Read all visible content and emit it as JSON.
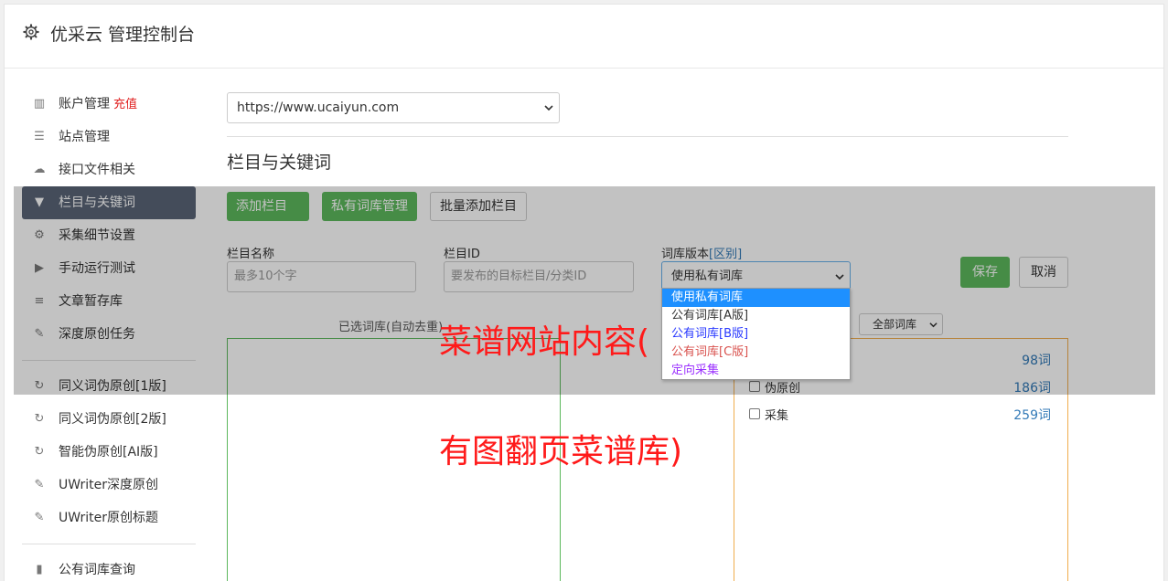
{
  "app": {
    "title": "优采云 管理控制台"
  },
  "sidebar": {
    "items": [
      {
        "label": "账户管理",
        "extra": "充值",
        "icon": "bar-chart-icon",
        "glyph": "▥"
      },
      {
        "label": "站点管理",
        "icon": "server-icon",
        "glyph": "☰"
      },
      {
        "label": "接口文件相关",
        "icon": "cloud-upload-icon",
        "glyph": "☁"
      },
      {
        "label": "栏目与关键词",
        "icon": "filter-icon",
        "glyph": "▼",
        "active": true
      },
      {
        "label": "采集细节设置",
        "icon": "cogs-icon",
        "glyph": "⚙"
      },
      {
        "label": "手动运行测试",
        "icon": "play-circle-icon",
        "glyph": "▶"
      },
      {
        "label": "文章暂存库",
        "icon": "database-icon",
        "glyph": "≡"
      },
      {
        "label": "深度原创任务",
        "icon": "edit-icon",
        "glyph": "✎"
      }
    ],
    "items2": [
      {
        "label": "同义词伪原创[1版]",
        "icon": "refresh-icon",
        "glyph": "↻"
      },
      {
        "label": "同义词伪原创[2版]",
        "icon": "refresh-icon",
        "glyph": "↻"
      },
      {
        "label": "智能伪原创[AI版]",
        "icon": "refresh-icon",
        "glyph": "↻"
      },
      {
        "label": "UWriter深度原创",
        "icon": "edit-icon",
        "glyph": "✎"
      },
      {
        "label": "UWriter原创标题",
        "icon": "edit-icon",
        "glyph": "✎"
      }
    ],
    "items3": [
      {
        "label": "公有词库查询",
        "icon": "book-icon",
        "glyph": "▮"
      }
    ]
  },
  "main": {
    "site_url": "https://www.ucaiyun.com",
    "section_title": "栏目与关键词",
    "buttons": {
      "add_column": "添加栏目 +",
      "private_lib": "私有词库管理",
      "batch_add": "批量添加栏目",
      "save": "保存",
      "cancel": "取消"
    },
    "form": {
      "name_label": "栏目名称",
      "name_placeholder": "最多10个字",
      "id_label": "栏目ID",
      "id_placeholder": "要发布的目标栏目/分类ID",
      "version_label": "词库版本",
      "version_link": "[区别]",
      "version_value": "使用私有词库"
    },
    "version_options": [
      "使用私有词库",
      "公有词库[A版]",
      "公有词库[B版]",
      "公有词库[C版]",
      "定向采集"
    ],
    "chosen_label": "已选词库(自动去重)",
    "filter_value": "全部词库",
    "libraries": [
      {
        "name": "",
        "count": "98词"
      },
      {
        "name": "伪原创",
        "count": "186词"
      },
      {
        "name": "采集",
        "count": "259词"
      }
    ]
  },
  "overlay": {
    "line1": "菜谱网站内容(",
    "line2": "有图翻页菜谱库)"
  },
  "colors": {
    "active_nav": "#5a6577",
    "green": "#5cb85c",
    "orange": "#f0ad4e",
    "link": "#337ab7",
    "red": "#ff1a1a"
  }
}
